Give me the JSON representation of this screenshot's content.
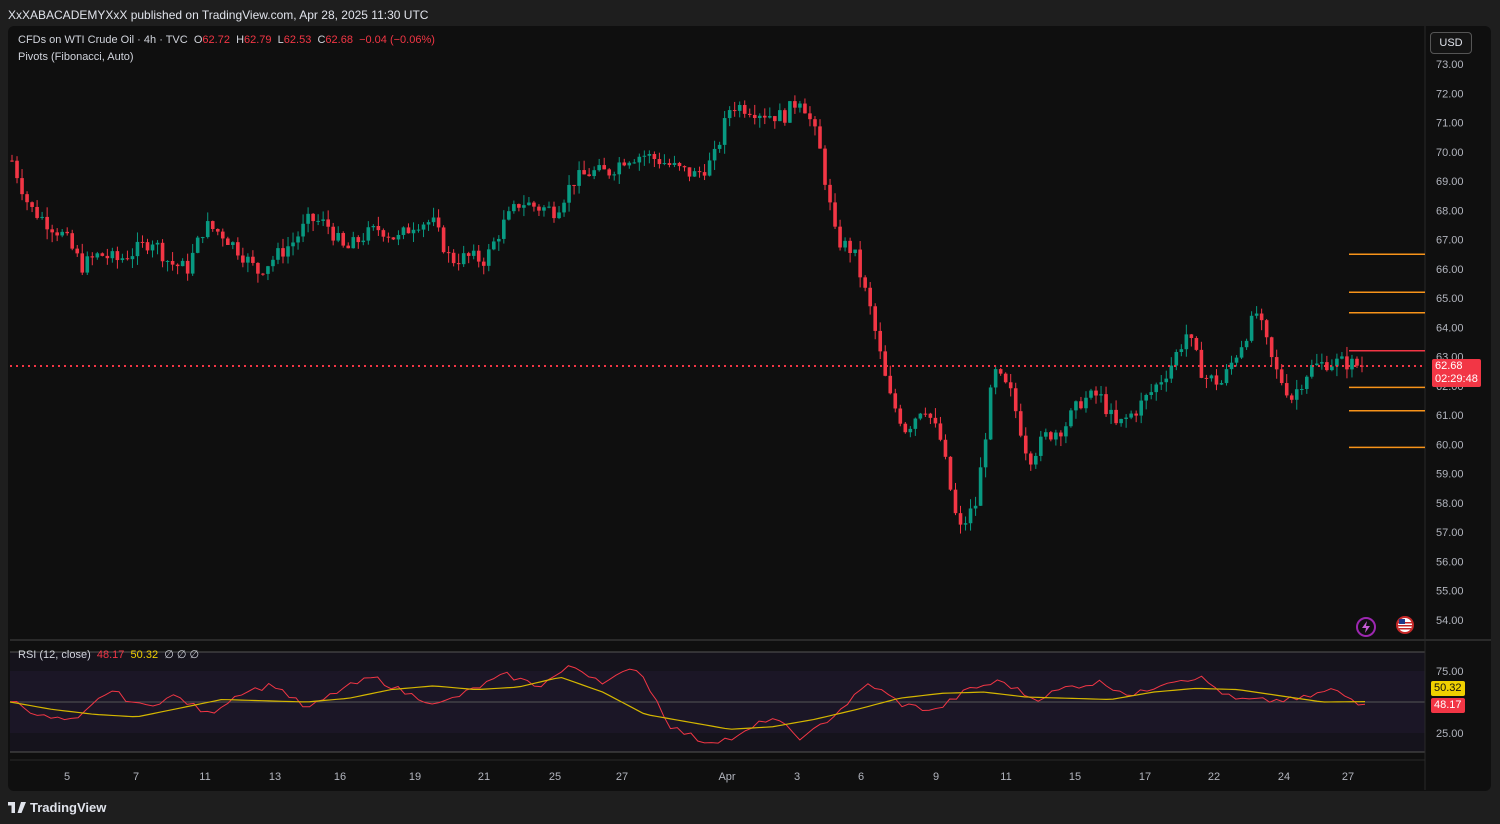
{
  "header": {
    "publisher_line": "XxXABACADEMYXxX published on TradingView.com, Apr 28, 2025 11:30 UTC"
  },
  "legend": {
    "symbol": "CFDs on WTI Crude Oil · 4h · TVC",
    "open_label": "O",
    "open": "62.72",
    "high_label": "H",
    "high": "62.79",
    "low_label": "L",
    "low": "62.53",
    "close_label": "C",
    "close": "62.68",
    "change": "−0.04 (−0.06%)",
    "indicator": "Pivots (Fibonacci, Auto)"
  },
  "rsi_legend": {
    "label": "RSI (12, close)",
    "rsi_value": "48.17",
    "ma_value": "50.32",
    "extras": "∅ ∅ ∅"
  },
  "currency_button": "USD",
  "price_tag": {
    "price": "62.68",
    "countdown": "02:29:48"
  },
  "rsi_tags": {
    "ma": "50.32",
    "rsi": "48.17"
  },
  "footer": {
    "brand": "TradingView"
  },
  "icons": [
    "lightning-icon",
    "us-flag-icon",
    "tradingview-logo-icon"
  ],
  "colors": {
    "up": "#089981",
    "down": "#f23645",
    "pivot": "#f7931a",
    "rsi": "#f23645",
    "rsi_ma": "#d4b600"
  },
  "chart_data": [
    {
      "type": "candlestick",
      "title": "CFDs on WTI Crude Oil · 4h · TVC",
      "y_ticks": [
        "73.00",
        "72.00",
        "71.00",
        "70.00",
        "69.00",
        "68.00",
        "67.00",
        "66.00",
        "65.00",
        "64.00",
        "63.00",
        "62.00",
        "61.00",
        "60.00",
        "59.00",
        "58.00",
        "57.00",
        "56.00",
        "55.00",
        "54.00"
      ],
      "ylim": [
        53.6,
        73.5
      ],
      "x_ticks": [
        "5",
        "7",
        "11",
        "13",
        "16",
        "19",
        "21",
        "25",
        "27",
        "Apr",
        "3",
        "6",
        "9",
        "11",
        "15",
        "17",
        "22",
        "24",
        "27"
      ],
      "ohlc_path_close": [
        69.7,
        68.1,
        67.6,
        67.1,
        66.1,
        66.5,
        66.3,
        66.6,
        67.0,
        66.2,
        66.0,
        67.5,
        67.2,
        66.6,
        65.9,
        66.4,
        66.9,
        67.7,
        67.5,
        66.6,
        67.1,
        67.4,
        67.0,
        67.6,
        67.6,
        66.3,
        66.4,
        66.3,
        67.5,
        68.3,
        68.1,
        68.0,
        69.0,
        69.3,
        69.3,
        69.8,
        69.9,
        69.7,
        69.4,
        69.2,
        69.7,
        71.6,
        71.5,
        71.3,
        71.2,
        71.9,
        70.3,
        67.0,
        66.6,
        64.5,
        61.7,
        60.5,
        61.4,
        60.1,
        57.0,
        58.0,
        62.5,
        61.7,
        59.5,
        60.3,
        60.6,
        61.5,
        61.7,
        60.6,
        61.1,
        61.8,
        62.6,
        63.8,
        62.3,
        62.1,
        63.3,
        64.5,
        62.6,
        61.6,
        62.6,
        62.8,
        62.8,
        62.68
      ],
      "last_price": 62.68,
      "pivot_levels": [
        66.5,
        65.2,
        64.5,
        63.2,
        61.95,
        61.15,
        59.9
      ]
    },
    {
      "type": "line",
      "title": "RSI (12, close)",
      "y_ticks": [
        "75.00",
        "25.00"
      ],
      "ylim": [
        16,
        91
      ],
      "series": [
        {
          "name": "RSI",
          "last": 48.17
        },
        {
          "name": "RSI MA",
          "last": 50.32
        }
      ],
      "rsi_keypoints": [
        52,
        38,
        34,
        60,
        46,
        55,
        40,
        58,
        64,
        44,
        60,
        70,
        57,
        48,
        60,
        72,
        63,
        79,
        66,
        78,
        30,
        18,
        21,
        38,
        20,
        41,
        65,
        48,
        43,
        60,
        67,
        52,
        62,
        66,
        55,
        67,
        70,
        52,
        51,
        52,
        60,
        47
      ],
      "ma_keypoints": [
        50,
        44,
        40,
        38,
        45,
        52,
        51,
        50,
        53,
        60,
        63,
        60,
        62,
        70,
        58,
        40,
        34,
        28,
        30,
        36,
        44,
        53,
        57,
        58,
        54,
        53,
        52,
        58,
        61,
        60,
        55,
        50,
        50.3
      ]
    }
  ]
}
